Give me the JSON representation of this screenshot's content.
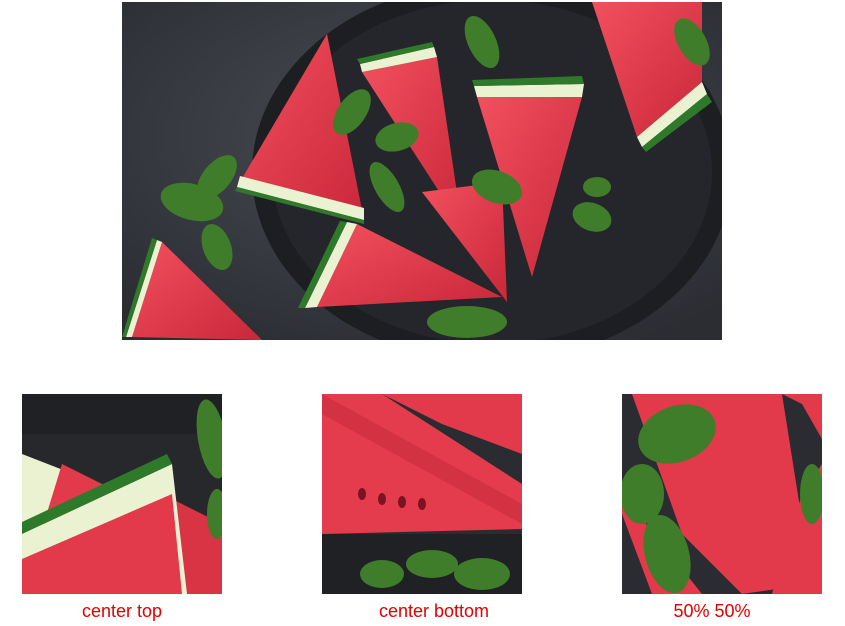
{
  "main_image": {
    "icon": "watermelon-photo",
    "alt_subject": "watermelon slices with mint on dark plate"
  },
  "crops": [
    {
      "caption": "center top",
      "icon": "watermelon-crop-top"
    },
    {
      "caption": "center bottom",
      "icon": "watermelon-crop-bottom"
    },
    {
      "caption": "50% 50%",
      "icon": "watermelon-crop-center"
    }
  ],
  "colors": {
    "caption": "#e00000",
    "background": "#ffffff",
    "flesh": "#e23a4a",
    "rind": "#2f7a2a",
    "pith": "#eaf2d2",
    "board": "#3c3e46",
    "plate": "#1f2125",
    "mint": "#3f7d2a"
  }
}
